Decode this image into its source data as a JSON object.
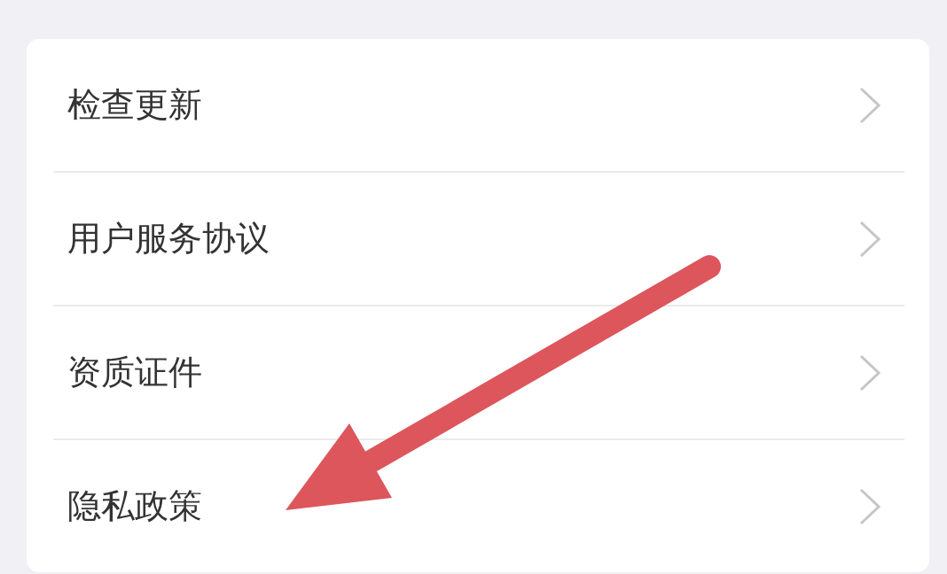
{
  "menu": {
    "items": [
      {
        "label": "检查更新"
      },
      {
        "label": "用户服务协议"
      },
      {
        "label": "资质证件"
      },
      {
        "label": "隐私政策"
      }
    ]
  }
}
